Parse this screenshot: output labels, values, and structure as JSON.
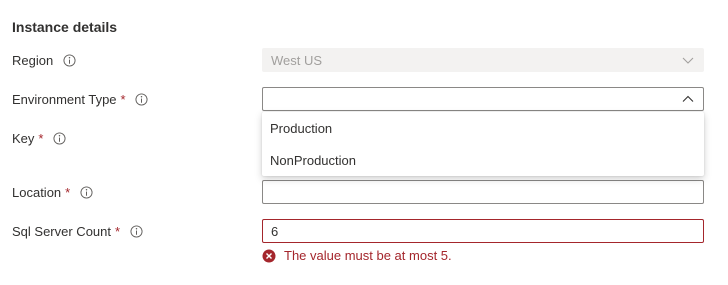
{
  "section": {
    "title": "Instance details"
  },
  "fields": {
    "region": {
      "label": "Region",
      "value": "West US",
      "icon": "chevron-down-icon"
    },
    "environment_type": {
      "label": "Environment Type",
      "required_mark": "*",
      "value": "",
      "icon": "chevron-up-icon",
      "options": [
        "Production",
        "NonProduction"
      ]
    },
    "key": {
      "label": "Key",
      "required_mark": "*"
    },
    "location": {
      "label": "Location",
      "required_mark": "*",
      "value": ""
    },
    "sql_server_count": {
      "label": "Sql Server Count",
      "required_mark": "*",
      "value": "6",
      "error": "The value must be at most 5."
    }
  },
  "colors": {
    "required": "#a4262c",
    "error": "#a4262c",
    "disabled_bg": "#f3f2f1",
    "text": "#323130"
  }
}
